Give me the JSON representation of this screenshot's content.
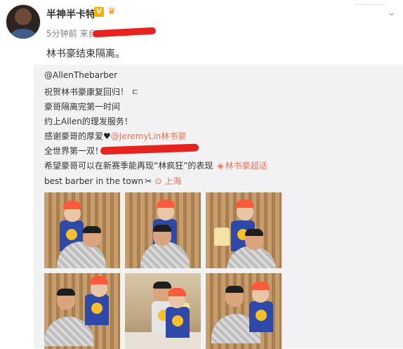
{
  "header": {
    "username": "半神半卡特",
    "vip_badge": "V",
    "time": "5分钟前",
    "from_label": "来自",
    "status_text": "林书豪结束隔离。",
    "more_icon": "chevron-down-icon"
  },
  "repost": {
    "author": "@AllenThebarber",
    "lines": {
      "l1": "祝贺林书豪康复回归！",
      "l1_tail": "ㄷ",
      "l2": "豪哥隔离完第一时间",
      "l3": "约上Allen的理发服务！",
      "l4_prefix": "感谢豪哥的厚爱",
      "l4_mention": "@JeremyLin林书豪",
      "l5": "全世界第一双！",
      "l6_prefix": "希望豪哥可以在新赛季能再现“林疯狂”的表现",
      "l6_topic": "林书豪超话",
      "l7_prefix": "best barber in the town",
      "l7_location": "上海"
    },
    "accent_color": "#eb7350"
  },
  "images": [
    {
      "id": "img-1"
    },
    {
      "id": "img-2"
    },
    {
      "id": "img-3"
    },
    {
      "id": "img-4"
    },
    {
      "id": "img-5"
    },
    {
      "id": "img-6"
    }
  ]
}
